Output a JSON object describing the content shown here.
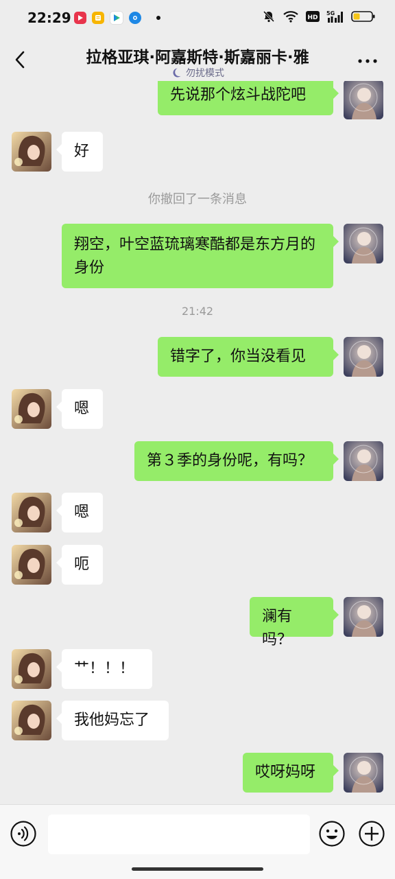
{
  "status_bar": {
    "time": "22:29",
    "apps": [
      "video-app-icon",
      "notes-app-icon",
      "play-app-icon",
      "browser-app-icon"
    ],
    "battery_color": "#f5c518"
  },
  "header": {
    "title": "拉格亚琪·阿嘉斯特·斯嘉丽卡·雅",
    "subtitle": "勿扰模式"
  },
  "messages": [
    {
      "kind": "bubble",
      "side": "out",
      "text": "先说那个炫斗战陀吧"
    },
    {
      "kind": "bubble",
      "side": "in",
      "text": "好"
    },
    {
      "kind": "system",
      "text": "你撤回了一条消息"
    },
    {
      "kind": "bubble",
      "side": "out",
      "text": "翔空，叶空蓝琉璃寒酷都是东方月的身份"
    },
    {
      "kind": "time",
      "text": "21:42"
    },
    {
      "kind": "bubble",
      "side": "out",
      "text": "错字了，你当没看见"
    },
    {
      "kind": "bubble",
      "side": "in",
      "text": "嗯"
    },
    {
      "kind": "bubble",
      "side": "out",
      "text": "第３季的身份呢，有吗？"
    },
    {
      "kind": "bubble",
      "side": "in",
      "text": "嗯"
    },
    {
      "kind": "bubble",
      "side": "in",
      "text": "呃"
    },
    {
      "kind": "bubble",
      "side": "out",
      "text": "澜有吗？"
    },
    {
      "kind": "bubble",
      "side": "in",
      "text": "艹！！！"
    },
    {
      "kind": "bubble",
      "side": "in",
      "text": "我他妈忘了"
    },
    {
      "kind": "bubble",
      "side": "out",
      "text": "哎呀妈呀"
    }
  ],
  "input": {
    "placeholder": ""
  },
  "colors": {
    "bubble_out": "#95ec69",
    "bubble_in": "#ffffff",
    "background": "#ededed"
  }
}
